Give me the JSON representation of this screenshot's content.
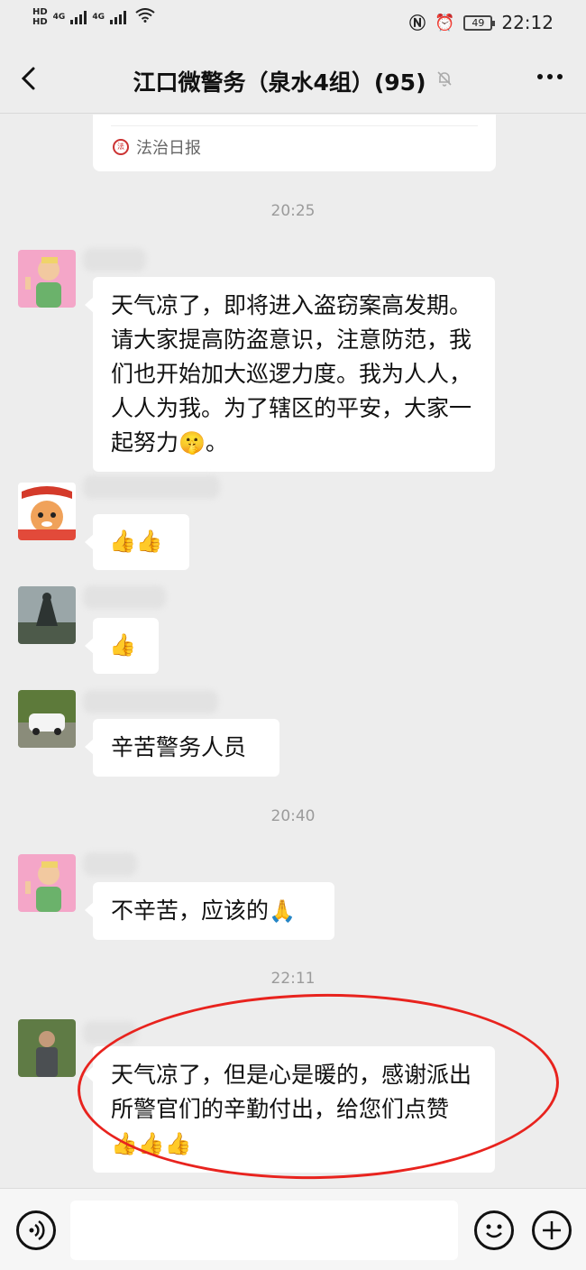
{
  "status_bar": {
    "hd1": "HD",
    "hd2": "HD",
    "net1": "4G",
    "net2": "4G",
    "battery": "49",
    "time": "22:12"
  },
  "header": {
    "title": "江口微警务（泉水4组）(95)",
    "back_icon": "back-arrow-icon",
    "mute_icon": "bell-muted-icon",
    "more_icon": "more-dots-icon"
  },
  "shared_card": {
    "source": "法治日报"
  },
  "messages": [
    {
      "time": "20:25"
    },
    {
      "text": "天气凉了，即将进入盗窃案高发期。请大家提高防盗意识，注意防范，我们也开始加大巡逻力度。我为人人，人人为我。为了辖区的平安，大家一起努力",
      "emoji": "🤫",
      "tail": "。"
    },
    {
      "emoji": "👍👍"
    },
    {
      "emoji": "👍"
    },
    {
      "text": "辛苦警务人员"
    },
    {
      "time": "20:40"
    },
    {
      "text": "不辛苦，应该的",
      "emoji": "🙏"
    },
    {
      "time": "22:11"
    },
    {
      "text": "天气凉了，但是心是暖的，感谢派出所警官们的辛勤付出，给您们点赞",
      "emoji": "👍👍👍"
    }
  ],
  "input_bar": {
    "voice_icon": "voice-icon",
    "emoji_icon": "smiley-icon",
    "plus_icon": "plus-icon",
    "placeholder": ""
  },
  "colors": {
    "background": "#ededed",
    "bubble": "#ffffff",
    "annotation_ring": "#e8231e"
  }
}
